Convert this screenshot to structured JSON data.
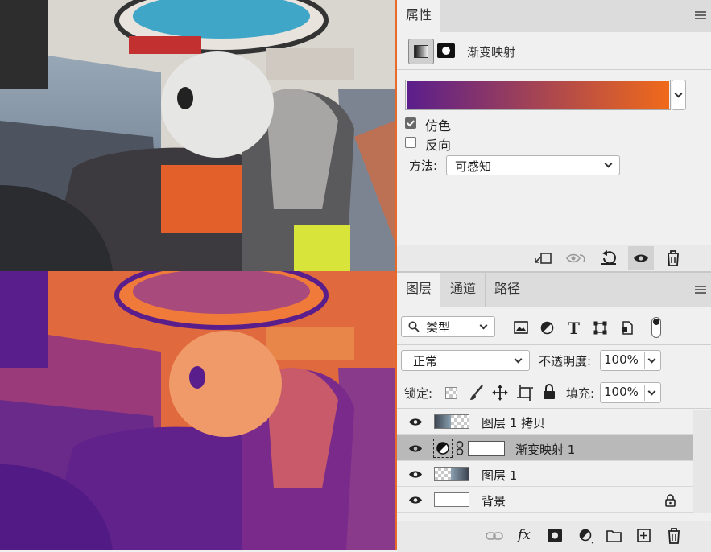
{
  "colors": {
    "gradient_start": "#5a1e8c",
    "gradient_end": "#f06a1a",
    "accent_rule": "#e86a2a",
    "selected_row": "#b9b9b9"
  },
  "properties_panel": {
    "tab": "属性",
    "adjustment_name": "渐变映射",
    "dither_label": "仿色",
    "dither_checked": true,
    "reverse_label": "反向",
    "reverse_checked": false,
    "method_label": "方法:",
    "method_value": "可感知",
    "footer_icons": [
      "clip-to-layer-icon",
      "view-previous-icon",
      "reset-icon",
      "visibility-eye-icon",
      "trash-icon"
    ]
  },
  "layers_panel": {
    "tabs": [
      "图层",
      "通道",
      "路径"
    ],
    "filter_kind": "类型",
    "filter_icons": [
      "image-filter-icon",
      "adjustment-filter-icon",
      "type-filter-icon",
      "shape-filter-icon",
      "smart-object-filter-icon",
      "filter-toggle-icon"
    ],
    "blend_mode": "正常",
    "opacity_label": "不透明度:",
    "opacity_value": "100%",
    "lock_label": "锁定:",
    "fill_label": "填充:",
    "fill_value": "100%",
    "layers": [
      {
        "name": "图层 1 拷贝",
        "visible": true,
        "selected": false,
        "locked": false
      },
      {
        "name": "渐变映射 1",
        "visible": true,
        "selected": true,
        "locked": false
      },
      {
        "name": "图层 1",
        "visible": true,
        "selected": false,
        "locked": false
      },
      {
        "name": "背景",
        "visible": true,
        "selected": false,
        "locked": true
      }
    ],
    "footer_icons": [
      "link-layers-icon",
      "fx-icon",
      "add-mask-icon",
      "new-adjustment-icon",
      "new-group-icon",
      "new-layer-icon",
      "delete-layer-icon"
    ],
    "fx_label": "fx"
  }
}
